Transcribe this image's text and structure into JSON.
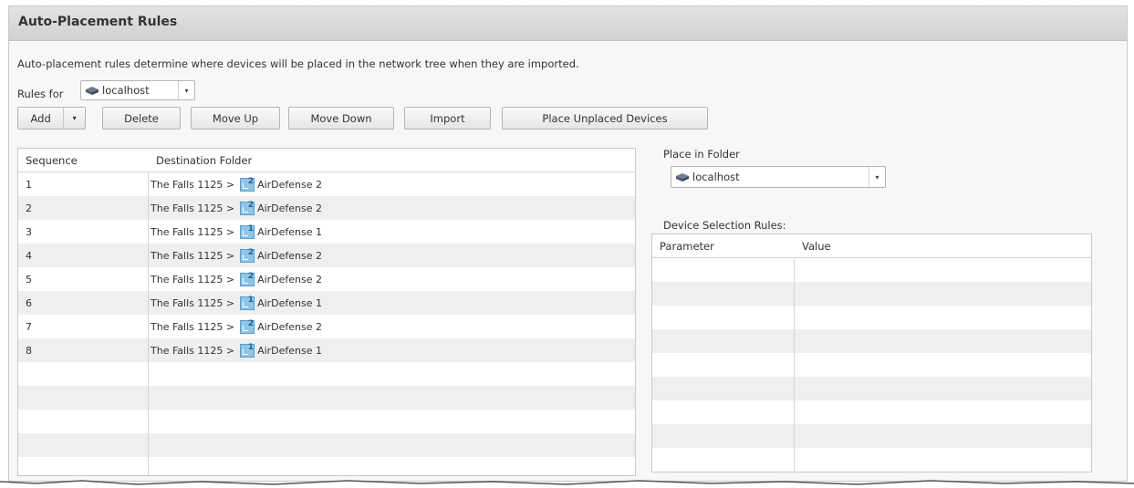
{
  "header": {
    "title": "Auto-Placement Rules"
  },
  "description": "Auto-placement rules determine where devices will be placed in the network tree when they are imported.",
  "rules_for": {
    "label": "Rules for",
    "value": "localhost",
    "icon": "server-icon"
  },
  "toolbar": {
    "add_label": "Add",
    "delete_label": "Delete",
    "move_up_label": "Move Up",
    "move_down_label": "Move Down",
    "import_label": "Import",
    "place_unplaced_label": "Place Unplaced Devices"
  },
  "rules_table": {
    "columns": [
      "Sequence",
      "Destination Folder"
    ],
    "rows": [
      {
        "sequence": "1",
        "path": "The Falls 1125 >",
        "folder": "AirDefense 2",
        "badge": "2"
      },
      {
        "sequence": "2",
        "path": "The Falls 1125 >",
        "folder": "AirDefense 2",
        "badge": "2"
      },
      {
        "sequence": "3",
        "path": "The Falls 1125 >",
        "folder": "AirDefense 1",
        "badge": "1"
      },
      {
        "sequence": "4",
        "path": "The Falls 1125 >",
        "folder": "AirDefense 2",
        "badge": "2"
      },
      {
        "sequence": "5",
        "path": "The Falls 1125 >",
        "folder": "AirDefense 2",
        "badge": "2"
      },
      {
        "sequence": "6",
        "path": "The Falls 1125 >",
        "folder": "AirDefense 1",
        "badge": "1"
      },
      {
        "sequence": "7",
        "path": "The Falls 1125 >",
        "folder": "AirDefense 2",
        "badge": "2"
      },
      {
        "sequence": "8",
        "path": "The Falls 1125 >",
        "folder": "AirDefense 1",
        "badge": "1"
      }
    ]
  },
  "place_in_folder": {
    "label": "Place in Folder",
    "value": "localhost",
    "icon": "server-icon"
  },
  "device_selection": {
    "label": "Device Selection Rules:",
    "columns": [
      "Parameter",
      "Value"
    ]
  },
  "colors": {
    "header_bg": "#d8d8d8",
    "folder_icon": "#8fc6e8"
  }
}
